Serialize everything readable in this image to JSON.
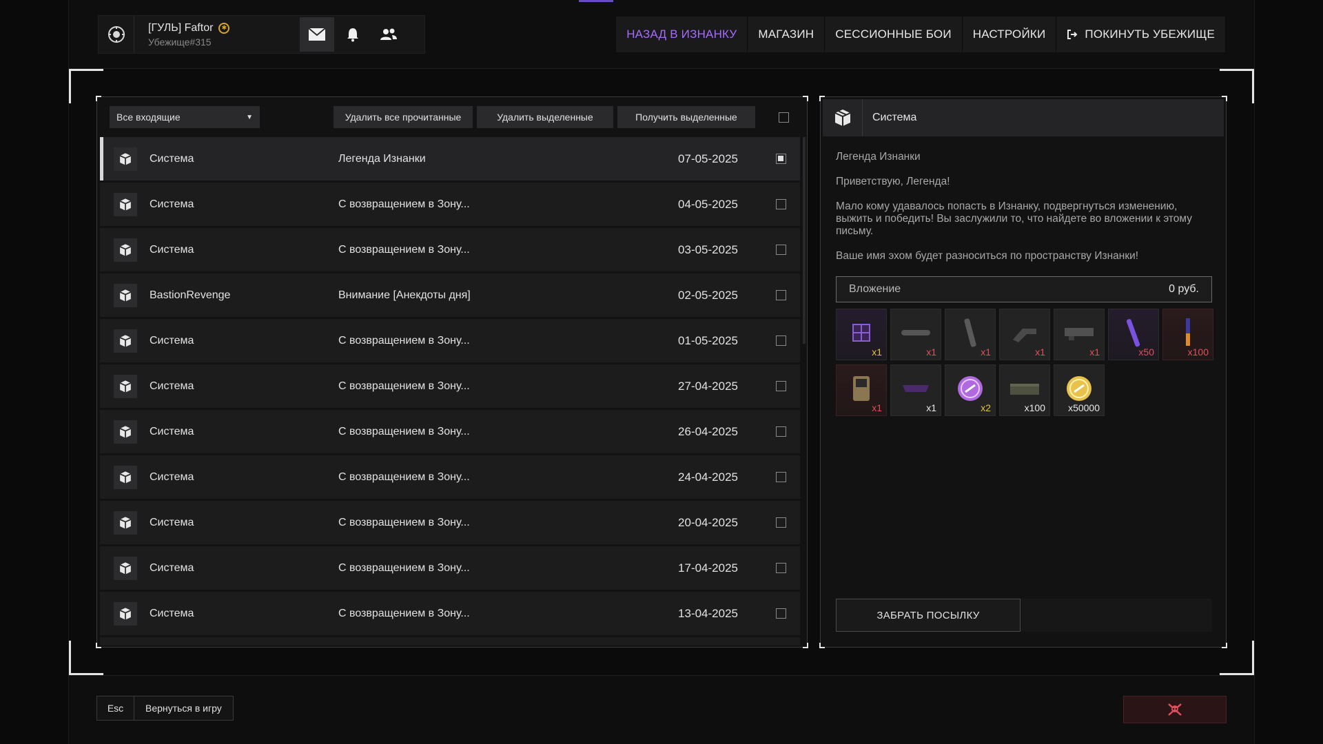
{
  "header": {
    "player_name": "[ГУЛЬ] Faftor",
    "player_sub": "Убежище#315",
    "nav": [
      {
        "label": "НАЗАД В ИЗНАНКУ",
        "active": true
      },
      {
        "label": "МАГАЗИН"
      },
      {
        "label": "СЕССИОННЫЕ БОИ"
      },
      {
        "label": "НАСТРОЙКИ"
      },
      {
        "label": "ПОКИНУТЬ УБЕЖИЩЕ",
        "icon": "exit-icon"
      }
    ],
    "accent_color": "#a56cff"
  },
  "inbox": {
    "filter_value": "Все входящие",
    "btn_delete_read": "Удалить все прочитанные",
    "btn_delete_selected": "Удалить выделенные",
    "btn_get_selected": "Получить выделенные",
    "rows": [
      {
        "sender": "Система",
        "subject": "Легенда Изнанки",
        "date": "07-05-2025",
        "checked": true,
        "selected": true
      },
      {
        "sender": "Система",
        "subject": "С возвращением в Зону...",
        "date": "04-05-2025",
        "checked": false
      },
      {
        "sender": "Система",
        "subject": "С возвращением в Зону...",
        "date": "03-05-2025",
        "checked": false
      },
      {
        "sender": "BastionRevenge",
        "subject": "Внимание [Анекдоты дня]",
        "date": "02-05-2025",
        "checked": false
      },
      {
        "sender": "Система",
        "subject": "С возвращением в Зону...",
        "date": "01-05-2025",
        "checked": false
      },
      {
        "sender": "Система",
        "subject": "С возвращением в Зону...",
        "date": "27-04-2025",
        "checked": false
      },
      {
        "sender": "Система",
        "subject": "С возвращением в Зону...",
        "date": "26-04-2025",
        "checked": false
      },
      {
        "sender": "Система",
        "subject": "С возвращением в Зону...",
        "date": "24-04-2025",
        "checked": false
      },
      {
        "sender": "Система",
        "subject": "С возвращением в Зону...",
        "date": "20-04-2025",
        "checked": false
      },
      {
        "sender": "Система",
        "subject": "С возвращением в Зону...",
        "date": "17-04-2025",
        "checked": false
      },
      {
        "sender": "Система",
        "subject": "С возвращением в Зону...",
        "date": "13-04-2025",
        "checked": false
      }
    ]
  },
  "message": {
    "sender": "Система",
    "title": "Легенда Изнанки",
    "greeting": "Приветствую, Легенда!",
    "body": "Мало кому удавалось попасть в Изнанку, подвергнуться изменению, выжить и победить! Вы заслужили то, что найдете во вложении к этому письму.",
    "footer": "Ваше имя эхом будет разноситься по пространству Изнанки!",
    "attachment_label": "Вложение",
    "attachment_price": "0 руб.",
    "items": [
      {
        "icon": "crystal-cube-icon",
        "qty": "x1",
        "qty_color": "yellow",
        "tone": "purple"
      },
      {
        "icon": "suppressor-icon",
        "qty": "x1",
        "qty_color": "red",
        "tone": "gray"
      },
      {
        "icon": "barrel-icon",
        "qty": "x1",
        "qty_color": "red",
        "tone": "gray"
      },
      {
        "icon": "scope-icon",
        "qty": "x1",
        "qty_color": "red",
        "tone": "gray"
      },
      {
        "icon": "receiver-icon",
        "qty": "x1",
        "qty_color": "red",
        "tone": "gray"
      },
      {
        "icon": "purple-stick-icon",
        "qty": "x50",
        "qty_color": "red",
        "tone": "purple"
      },
      {
        "icon": "orange-stick-icon",
        "qty": "x100",
        "qty_color": "red",
        "tone": "red"
      },
      {
        "icon": "device-icon",
        "qty": "x1",
        "qty_color": "red",
        "tone": "red"
      },
      {
        "icon": "purple-part-icon",
        "qty": "x1",
        "qty_color": "white",
        "tone": "gray"
      },
      {
        "icon": "purple-chain-coin-icon",
        "qty": "x2",
        "qty_color": "yellow",
        "tone": "gray"
      },
      {
        "icon": "ammo-box-icon",
        "qty": "x100",
        "qty_color": "white",
        "tone": "gray"
      },
      {
        "icon": "gold-coin-icon",
        "qty": "x50000",
        "qty_color": "white",
        "tone": "gray"
      }
    ],
    "claim_label": "ЗАБРАТЬ ПОСЫЛКУ"
  },
  "footer": {
    "esc_key": "Esc",
    "back_label": "Вернуться в игру",
    "exit_icon": "skull-icon",
    "exit_color": "#e0505a"
  }
}
